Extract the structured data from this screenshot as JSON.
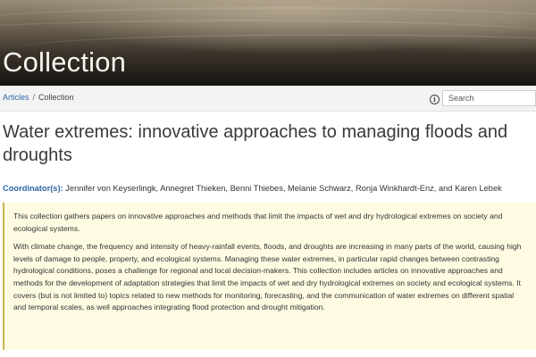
{
  "banner": {
    "title": "Collection"
  },
  "breadcrumb": {
    "articles": "Articles",
    "separator": "/",
    "current": "Collection"
  },
  "search": {
    "placeholder": "Search",
    "info_icon": "i"
  },
  "collection": {
    "title": "Water extremes: innovative approaches to managing floods and droughts",
    "coordinators_label": "Coordinator(s):",
    "coordinators": "Jennifer von Keyserlingk, Annegret Thieken, Benni Thiebes, Melanie Schwarz, Ronja Winkhardt-Enz, and Karen Lebek",
    "abstract": [
      "This collection gathers papers on innovative approaches and methods that limit the impacts of wet and dry hydrological extremes on society and ecological systems.",
      "With climate change, the frequency and intensity of heavy-rainfall events, floods, and droughts are increasing in many parts of the world, causing high levels of damage to people, property, and ecological systems. Managing these water extremes, in particular rapid changes between contrasting hydrological conditions, poses a challenge for regional and local decision-makers. This collection includes articles on innovative approaches and methods for the development of adaptation strategies that limit the impacts of wet and dry hydrological extremes on society and ecological systems. It covers (but is not limited to) topics related to new methods for monitoring, forecasting, and the communication of water extremes on different spatial and temporal scales, as well approaches integrating flood protection and drought mitigation."
    ]
  },
  "colors": {
    "link": "#2f66a8",
    "abstract_bg": "#fffbe2",
    "abstract_border": "#c9b64d"
  }
}
